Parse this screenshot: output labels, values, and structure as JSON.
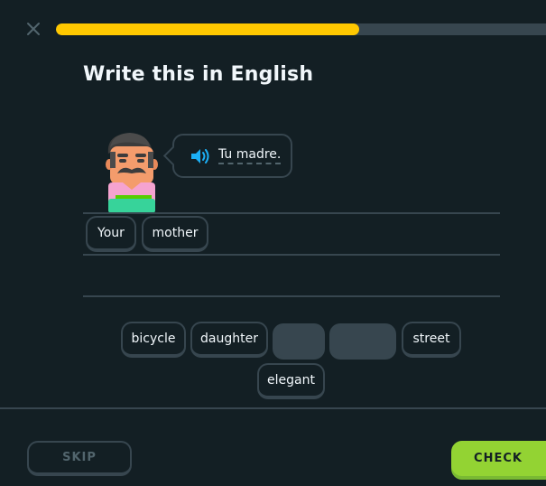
{
  "header": {
    "close_icon": "close-icon",
    "progress": 0.6
  },
  "prompt": {
    "title": "Write this in English",
    "sentence": "Tu madre.",
    "speaker_icon": "speaker-icon",
    "character_icon": "character-avatar"
  },
  "answer": {
    "selected": [
      "Your",
      "mother"
    ]
  },
  "word_bank": {
    "words": [
      "bicycle",
      "daughter",
      "street",
      "elegant"
    ]
  },
  "footer": {
    "skip_label": "SKIP",
    "check_label": "CHECK"
  },
  "colors": {
    "background": "#131f24",
    "border": "#37464f",
    "progress": "#ffc800",
    "check": "#93d333",
    "speaker": "#1cb0f6"
  }
}
